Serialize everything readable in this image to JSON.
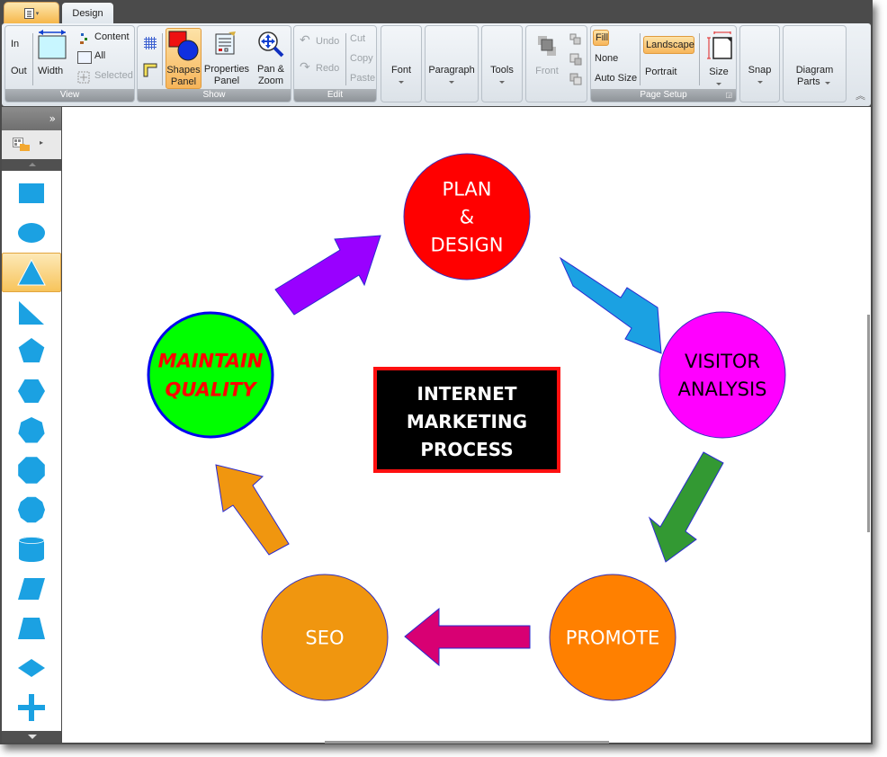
{
  "tabs": {
    "app_menu": "application-menu",
    "design": "Design"
  },
  "ribbon": {
    "view": {
      "label": "View",
      "zoom_in": "In",
      "zoom_out": "Out",
      "width": "Width",
      "content": "Content",
      "all": "All",
      "selected": "Selected"
    },
    "show": {
      "label": "Show",
      "shapes_panel": [
        "Shapes",
        "Panel"
      ],
      "properties_panel": [
        "Properties",
        "Panel"
      ],
      "pan_zoom": [
        "Pan &",
        "Zoom"
      ]
    },
    "edit": {
      "label": "Edit",
      "undo": "Undo",
      "redo": "Redo",
      "cut": "Cut",
      "copy": "Copy",
      "paste": "Paste"
    },
    "font": "Font",
    "paragraph": "Paragraph",
    "tools": "Tools",
    "arrange": {
      "front": "Front"
    },
    "page_setup": {
      "label": "Page Setup",
      "fill": "Fill",
      "none": "None",
      "auto_size": "Auto Size",
      "landscape": "Landscape",
      "portrait": "Portrait",
      "size": "Size"
    },
    "snap": "Snap",
    "diagram_parts": [
      "Diagram",
      "Parts"
    ]
  },
  "shapes_panel": {
    "items": [
      "rectangle",
      "ellipse",
      "triangle",
      "right-triangle",
      "pentagon",
      "hexagon",
      "heptagon",
      "octagon",
      "decagon",
      "cylinder",
      "parallelogram",
      "trapezoid",
      "diamond",
      "cross"
    ],
    "selected": "triangle",
    "color": "#1ba1e2"
  },
  "diagram": {
    "title": [
      "INTERNET",
      "MARKETING",
      "PROCESS"
    ],
    "nodes": [
      {
        "id": "plan",
        "lines": [
          "PLAN",
          "&",
          "DESIGN"
        ],
        "fill": "#ff0000",
        "text_color": "#ffffff"
      },
      {
        "id": "visitor",
        "lines": [
          "VISITOR",
          "ANALYSIS"
        ],
        "fill": "#ff00ff",
        "text_color": "#000000"
      },
      {
        "id": "promote",
        "lines": [
          "PROMOTE"
        ],
        "fill": "#ff8000",
        "text_color": "#ffffff"
      },
      {
        "id": "seo",
        "lines": [
          "SEO"
        ],
        "fill": "#f0960f",
        "text_color": "#ffffff"
      },
      {
        "id": "maintain",
        "lines": [
          "MAINTAIN",
          "QUALITY"
        ],
        "fill": "#00ff00",
        "text_color": "#ff0000"
      }
    ],
    "arrows": [
      {
        "from": "maintain",
        "to": "plan",
        "fill": "#9900ff"
      },
      {
        "from": "plan",
        "to": "visitor",
        "fill": "#1ba1e2"
      },
      {
        "from": "visitor",
        "to": "promote",
        "fill": "#339933"
      },
      {
        "from": "promote",
        "to": "seo",
        "fill": "#d80073"
      },
      {
        "from": "seo",
        "to": "maintain",
        "fill": "#f0960f"
      }
    ]
  }
}
